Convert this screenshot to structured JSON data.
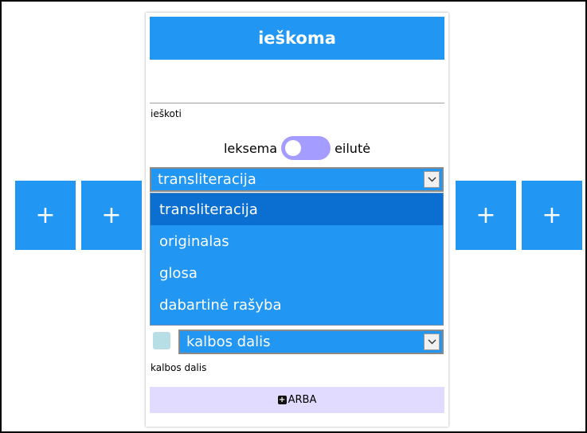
{
  "add_buttons": [
    {
      "label": "+"
    },
    {
      "label": "+"
    },
    {
      "label": "+"
    },
    {
      "label": "+"
    }
  ],
  "panel": {
    "title": "ieškoma",
    "search": {
      "value": "",
      "placeholder": "",
      "label": "ieškoti"
    },
    "toggle": {
      "left_label": "leksema",
      "right_label": "eilutė"
    },
    "field_select": {
      "value": "transliteracija",
      "options": [
        "transliteracija",
        "originalas",
        "glosa",
        "dabartinė rašyba"
      ],
      "highlighted_index": 0
    },
    "pos_select": {
      "value": "kalbos dalis",
      "label": "kalbos dalis"
    },
    "or_button": {
      "label": "ARBA",
      "icon": "plus-square-icon"
    }
  },
  "colors": {
    "accent": "#2196f3",
    "option_highlight": "#0a6fd0",
    "toggle": "#a59cff",
    "or_button_bg": "#e1dcff",
    "swatch": "#b7dde5"
  }
}
